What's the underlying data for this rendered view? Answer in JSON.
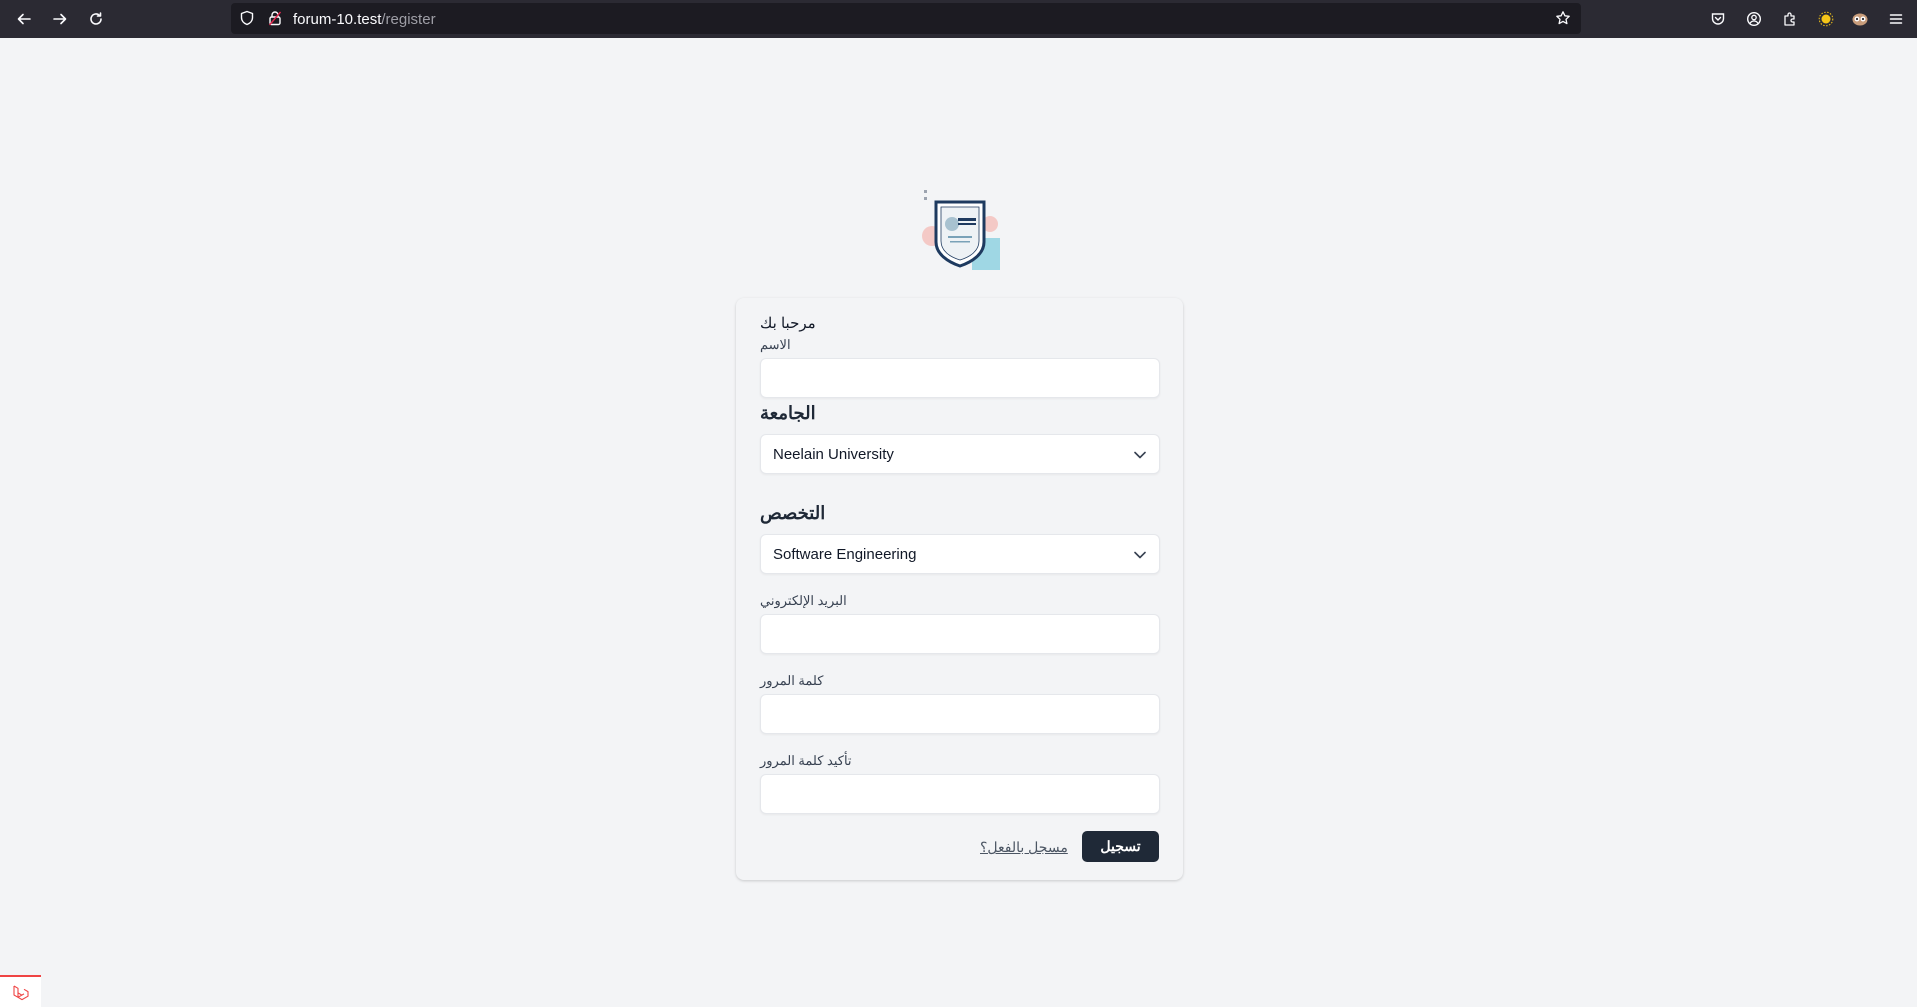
{
  "browser": {
    "url_host": "forum-10.test",
    "url_path": "/register",
    "icons": [
      "back-arrow-icon",
      "forward-arrow-icon",
      "reload-icon",
      "shield-icon",
      "lock-icon",
      "bookmark-star-icon",
      "pocket-icon",
      "account-icon",
      "extensions-icon",
      "sun-extension-icon",
      "owl-extension-icon",
      "hamburger-menu-icon"
    ]
  },
  "form": {
    "welcome": "مرحبا بك",
    "name_label": "الاسم",
    "name_value": "",
    "university_heading": "الجامعة",
    "university_selected": "Neelain University",
    "specialization_heading": "التخصص",
    "specialization_selected": "Software Engineering",
    "email_label": "البريد الإلكتروني",
    "email_value": "",
    "password_label": "كلمة المرور",
    "password_value": "",
    "confirm_password_label": "تأكيد كلمة المرور",
    "confirm_password_value": "",
    "already_registered_link": "مسجل بالفعل؟",
    "register_button": "تسجيل"
  },
  "colors": {
    "page_bg": "#f3f4f6",
    "toolbar_bg": "#2b2a33",
    "urlbar_bg": "#1c1b22",
    "button_bg": "#1f2937",
    "corner_accent": "#ef4444"
  }
}
